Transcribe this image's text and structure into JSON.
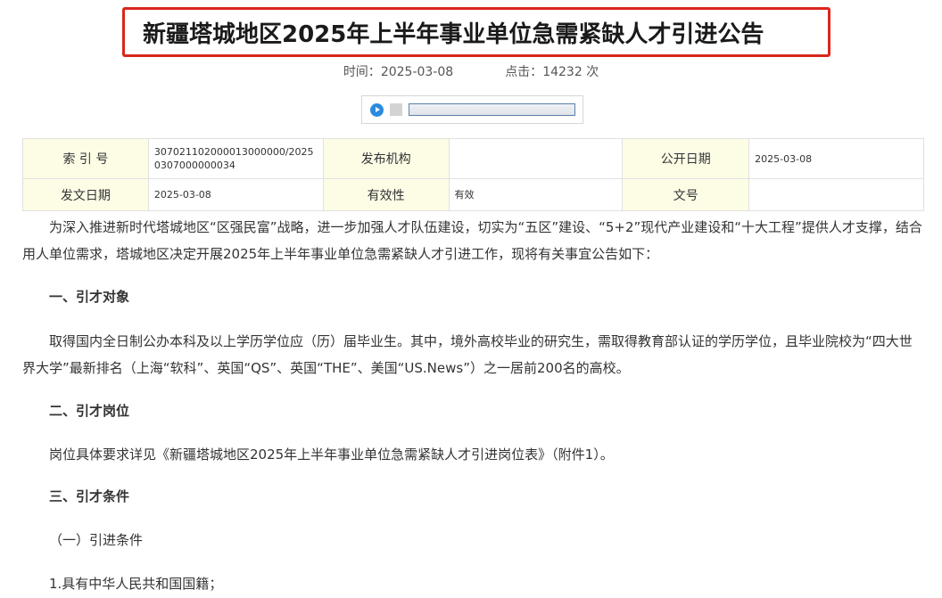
{
  "article": {
    "title": "新疆塔城地区2025年上半年事业单位急需紧缺人才引进公告",
    "time_label": "时间：",
    "time_value": "2025-03-08",
    "clicks_label": "点击：",
    "clicks_value": "14232",
    "clicks_unit": "次"
  },
  "player": {
    "play_icon": "play-icon",
    "stop_icon": "stop-icon",
    "progress": 0
  },
  "info_table": {
    "row1": {
      "index_label": "索 引 号",
      "index_value": "307021102000013000000/20250307000000034",
      "publisher_label": "发布机构",
      "publisher_value": "",
      "open_date_label": "公开日期",
      "open_date_value": "2025-03-08"
    },
    "row2": {
      "issue_date_label": "发文日期",
      "issue_date_value": "2025-03-08",
      "validity_label": "有效性",
      "validity_value": "有效",
      "doc_no_label": "文号",
      "doc_no_value": ""
    }
  },
  "body": {
    "intro": "为深入推进新时代塔城地区“区强民富”战略，进一步加强人才队伍建设，切实为“五区”建设、“5+2”现代产业建设和“十大工程”提供人才支撑，结合用人单位需求，塔城地区决定开展2025年上半年事业单位急需紧缺人才引进工作，现将有关事宜公告如下：",
    "section1_title": "一、引才对象",
    "section1_text": "取得国内全日制公办本科及以上学历学位应（历）届毕业生。其中，境外高校毕业的研究生，需取得教育部认证的学历学位，且毕业院校为“四大世界大学”最新排名（上海“软科”、英国“QS”、英国“THE”、美国“US.News”）之一居前200名的高校。",
    "section2_title": "二、引才岗位",
    "section2_text": "岗位具体要求详见《新疆塔城地区2025年上半年事业单位急需紧缺人才引进岗位表》（附件1）。",
    "section3_title": "三、引才条件",
    "sub1_title": "（一）引进条件",
    "item1": "1.具有中华人民共和国国籍；"
  }
}
